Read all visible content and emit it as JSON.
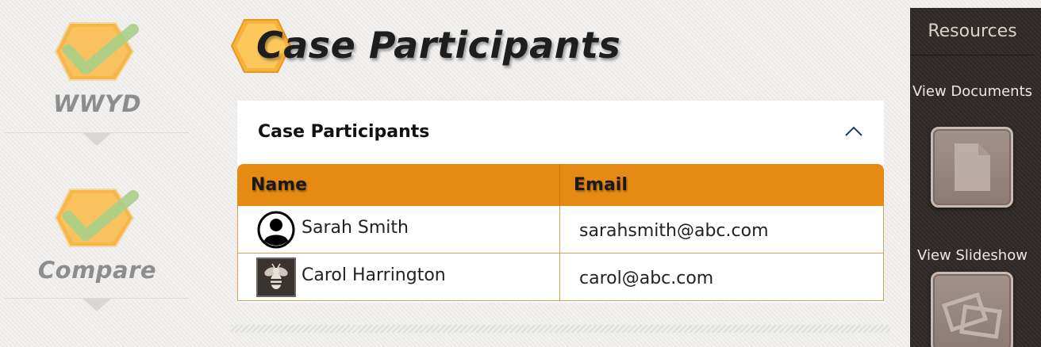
{
  "steps": [
    {
      "label": "WWYD",
      "icon": "hex-check-icon"
    },
    {
      "label": "Compare",
      "icon": "hex-check-icon"
    }
  ],
  "page": {
    "title": "Case Participants"
  },
  "card": {
    "title": "Case Participants",
    "collapse_icon": "chevron-up-icon",
    "table": {
      "headers": [
        "Name",
        "Email"
      ],
      "rows": [
        {
          "name": "Sarah Smith",
          "email": "sarahsmith@abc.com",
          "avatar": "user-circle-icon"
        },
        {
          "name": "Carol Harrington",
          "email": "carol@abc.com",
          "avatar": "bee-photo"
        }
      ]
    }
  },
  "resources": {
    "title": "Resources",
    "items": [
      {
        "label": "View Documents",
        "icon": "document-icon"
      },
      {
        "label": "View Slideshow",
        "icon": "slideshow-icon"
      }
    ]
  },
  "colors": {
    "accent": "#e68a14",
    "hex_fill": "#f7b64a",
    "check": "#a8cf8a",
    "panel": "#2f2a27"
  }
}
